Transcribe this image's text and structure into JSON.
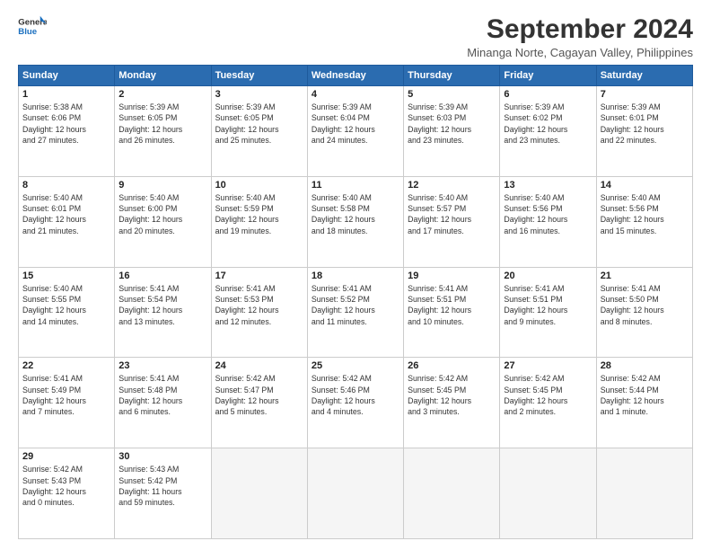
{
  "header": {
    "logo_line1": "General",
    "logo_line2": "Blue",
    "title": "September 2024",
    "subtitle": "Minanga Norte, Cagayan Valley, Philippines"
  },
  "columns": [
    "Sunday",
    "Monday",
    "Tuesday",
    "Wednesday",
    "Thursday",
    "Friday",
    "Saturday"
  ],
  "weeks": [
    [
      {
        "day": "1",
        "info": "Sunrise: 5:38 AM\nSunset: 6:06 PM\nDaylight: 12 hours\nand 27 minutes."
      },
      {
        "day": "2",
        "info": "Sunrise: 5:39 AM\nSunset: 6:05 PM\nDaylight: 12 hours\nand 26 minutes."
      },
      {
        "day": "3",
        "info": "Sunrise: 5:39 AM\nSunset: 6:05 PM\nDaylight: 12 hours\nand 25 minutes."
      },
      {
        "day": "4",
        "info": "Sunrise: 5:39 AM\nSunset: 6:04 PM\nDaylight: 12 hours\nand 24 minutes."
      },
      {
        "day": "5",
        "info": "Sunrise: 5:39 AM\nSunset: 6:03 PM\nDaylight: 12 hours\nand 23 minutes."
      },
      {
        "day": "6",
        "info": "Sunrise: 5:39 AM\nSunset: 6:02 PM\nDaylight: 12 hours\nand 23 minutes."
      },
      {
        "day": "7",
        "info": "Sunrise: 5:39 AM\nSunset: 6:01 PM\nDaylight: 12 hours\nand 22 minutes."
      }
    ],
    [
      {
        "day": "8",
        "info": "Sunrise: 5:40 AM\nSunset: 6:01 PM\nDaylight: 12 hours\nand 21 minutes."
      },
      {
        "day": "9",
        "info": "Sunrise: 5:40 AM\nSunset: 6:00 PM\nDaylight: 12 hours\nand 20 minutes."
      },
      {
        "day": "10",
        "info": "Sunrise: 5:40 AM\nSunset: 5:59 PM\nDaylight: 12 hours\nand 19 minutes."
      },
      {
        "day": "11",
        "info": "Sunrise: 5:40 AM\nSunset: 5:58 PM\nDaylight: 12 hours\nand 18 minutes."
      },
      {
        "day": "12",
        "info": "Sunrise: 5:40 AM\nSunset: 5:57 PM\nDaylight: 12 hours\nand 17 minutes."
      },
      {
        "day": "13",
        "info": "Sunrise: 5:40 AM\nSunset: 5:56 PM\nDaylight: 12 hours\nand 16 minutes."
      },
      {
        "day": "14",
        "info": "Sunrise: 5:40 AM\nSunset: 5:56 PM\nDaylight: 12 hours\nand 15 minutes."
      }
    ],
    [
      {
        "day": "15",
        "info": "Sunrise: 5:40 AM\nSunset: 5:55 PM\nDaylight: 12 hours\nand 14 minutes."
      },
      {
        "day": "16",
        "info": "Sunrise: 5:41 AM\nSunset: 5:54 PM\nDaylight: 12 hours\nand 13 minutes."
      },
      {
        "day": "17",
        "info": "Sunrise: 5:41 AM\nSunset: 5:53 PM\nDaylight: 12 hours\nand 12 minutes."
      },
      {
        "day": "18",
        "info": "Sunrise: 5:41 AM\nSunset: 5:52 PM\nDaylight: 12 hours\nand 11 minutes."
      },
      {
        "day": "19",
        "info": "Sunrise: 5:41 AM\nSunset: 5:51 PM\nDaylight: 12 hours\nand 10 minutes."
      },
      {
        "day": "20",
        "info": "Sunrise: 5:41 AM\nSunset: 5:51 PM\nDaylight: 12 hours\nand 9 minutes."
      },
      {
        "day": "21",
        "info": "Sunrise: 5:41 AM\nSunset: 5:50 PM\nDaylight: 12 hours\nand 8 minutes."
      }
    ],
    [
      {
        "day": "22",
        "info": "Sunrise: 5:41 AM\nSunset: 5:49 PM\nDaylight: 12 hours\nand 7 minutes."
      },
      {
        "day": "23",
        "info": "Sunrise: 5:41 AM\nSunset: 5:48 PM\nDaylight: 12 hours\nand 6 minutes."
      },
      {
        "day": "24",
        "info": "Sunrise: 5:42 AM\nSunset: 5:47 PM\nDaylight: 12 hours\nand 5 minutes."
      },
      {
        "day": "25",
        "info": "Sunrise: 5:42 AM\nSunset: 5:46 PM\nDaylight: 12 hours\nand 4 minutes."
      },
      {
        "day": "26",
        "info": "Sunrise: 5:42 AM\nSunset: 5:45 PM\nDaylight: 12 hours\nand 3 minutes."
      },
      {
        "day": "27",
        "info": "Sunrise: 5:42 AM\nSunset: 5:45 PM\nDaylight: 12 hours\nand 2 minutes."
      },
      {
        "day": "28",
        "info": "Sunrise: 5:42 AM\nSunset: 5:44 PM\nDaylight: 12 hours\nand 1 minute."
      }
    ],
    [
      {
        "day": "29",
        "info": "Sunrise: 5:42 AM\nSunset: 5:43 PM\nDaylight: 12 hours\nand 0 minutes."
      },
      {
        "day": "30",
        "info": "Sunrise: 5:43 AM\nSunset: 5:42 PM\nDaylight: 11 hours\nand 59 minutes."
      },
      {
        "day": "",
        "info": ""
      },
      {
        "day": "",
        "info": ""
      },
      {
        "day": "",
        "info": ""
      },
      {
        "day": "",
        "info": ""
      },
      {
        "day": "",
        "info": ""
      }
    ]
  ]
}
